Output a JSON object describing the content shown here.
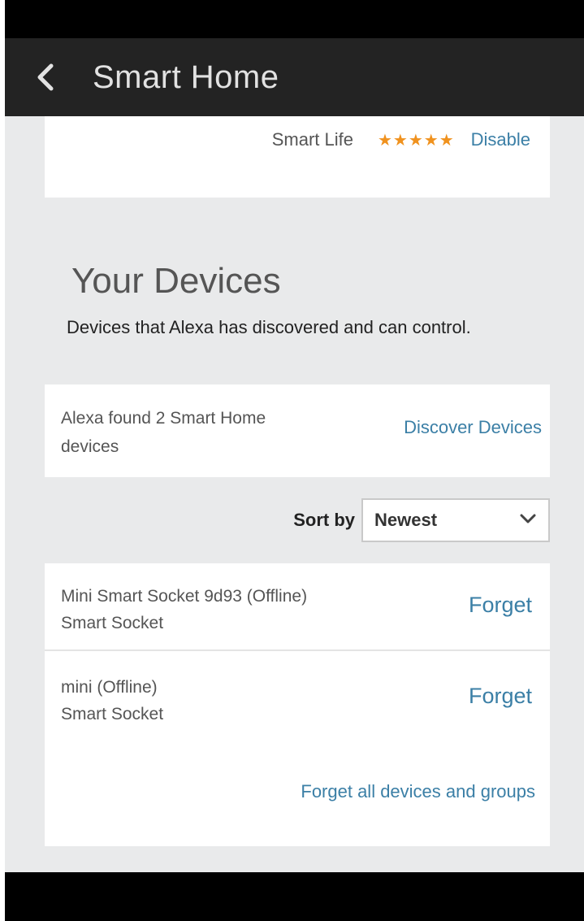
{
  "header": {
    "title": "Smart Home",
    "back_icon": "chevron-left-icon"
  },
  "skill": {
    "name": "Smart Life",
    "rating_stars": 5,
    "stars_text": "★★★★★",
    "disable_label": "Disable"
  },
  "devices_section": {
    "title": "Your Devices",
    "description": "Devices that Alexa has discovered and can control.",
    "discover_text": "Alexa found 2 Smart Home devices",
    "discover_label": "Discover Devices"
  },
  "sort": {
    "label": "Sort by",
    "selected": "Newest"
  },
  "device_list": [
    {
      "name": "Mini Smart Socket 9d93 (Offline)",
      "type": "Smart Socket",
      "action": "Forget"
    },
    {
      "name": "mini (Offline)",
      "type": "Smart Socket",
      "action": "Forget"
    }
  ],
  "forget_all_label": "Forget all devices and groups",
  "colors": {
    "header_bg": "#232323",
    "page_bg": "#e9eaeb",
    "link": "#3b7fa6",
    "stars": "#f0921e"
  }
}
